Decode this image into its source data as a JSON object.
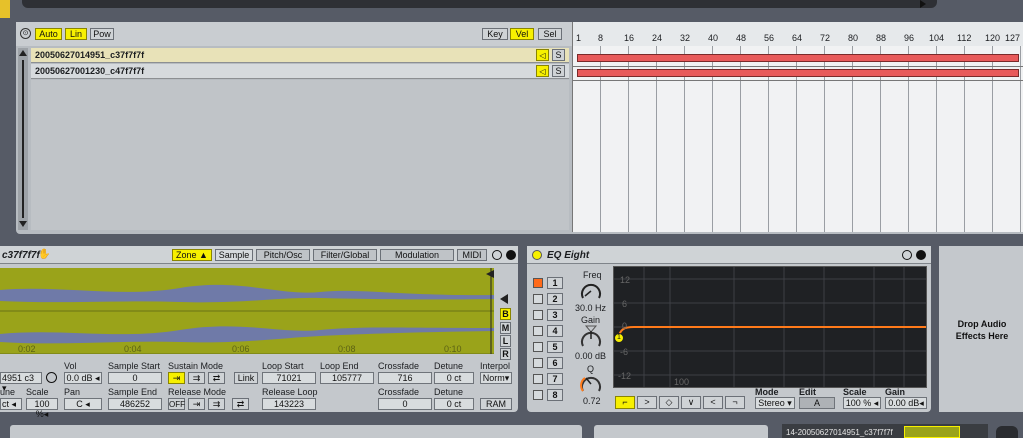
{
  "clip": {
    "buttons": {
      "auto": "Auto",
      "lin": "Lin",
      "pow": "Pow",
      "key": "Key",
      "vel": "Vel",
      "sel": "Sel"
    },
    "ruler": [
      "1",
      "8",
      "16",
      "24",
      "32",
      "40",
      "48",
      "56",
      "64",
      "72",
      "80",
      "88",
      "96",
      "104",
      "112",
      "120",
      "127"
    ],
    "tracks": [
      {
        "name": "20050627014951_c37f7f7f",
        "solo": "S"
      },
      {
        "name": "20050627001230_c47f7f7f",
        "solo": "S"
      }
    ]
  },
  "sampler": {
    "title": "c37f7f7f",
    "tabs": {
      "zone": "Zone",
      "sample": "Sample",
      "pitch": "Pitch/Osc",
      "filter": "Filter/Global",
      "modulation": "Modulation",
      "midi": "MIDI"
    },
    "side_buttons": [
      "B",
      "M",
      "L",
      "R"
    ],
    "timeline": [
      "0:02",
      "0:04",
      "0:06",
      "0:08",
      "0:10"
    ],
    "params": {
      "sample_field": "4951 c3",
      "vol_label": "Vol",
      "vol": "0.0 dB",
      "sample_start_label": "Sample Start",
      "sample_start": "0",
      "sustain_mode_label": "Sustain Mode",
      "link": "Link",
      "loop_start_label": "Loop Start",
      "loop_start": "71021",
      "loop_end_label": "Loop End",
      "loop_end": "105777",
      "crossfade_label": "Crossfade",
      "crossfade": "716",
      "detune_label": "Detune",
      "detune": "0 ct",
      "interpol_label": "Interpol",
      "interpol": "Norm",
      "tune_label": "une",
      "scale_label": "Scale",
      "scale": "100 %",
      "tune_field": "ct",
      "pan_label": "Pan",
      "pan": "C",
      "sample_end_label": "Sample End",
      "sample_end": "486252",
      "release_mode_label": "Release Mode",
      "release_off": "OFF",
      "release_loop_label": "Release Loop",
      "release_loop": "143223",
      "crossfade2_label": "Crossfade",
      "crossfade2": "0",
      "detune2_label": "Detune",
      "detune2": "0 ct",
      "ram": "RAM"
    }
  },
  "eq": {
    "title": "EQ Eight",
    "bands": [
      "1",
      "2",
      "3",
      "4",
      "5",
      "6",
      "7",
      "8"
    ],
    "freq_label": "Freq",
    "freq": "30.0 Hz",
    "gain_label": "Gain",
    "gain": "0.00 dB",
    "q_label": "Q",
    "q": "0.72",
    "y_ticks": [
      "12",
      "6",
      "0",
      "-6",
      "-12"
    ],
    "x_tick": "100",
    "mode_label": "Mode",
    "mode": "Stereo",
    "edit_label": "Edit",
    "edit": "A",
    "scale_label": "Scale",
    "scale": "100 %",
    "gain_out_label": "Gain",
    "gain_out": "0.00 dB"
  },
  "drop": {
    "text": "Drop Audio Effects Here"
  },
  "footer": {
    "clip_name": "14-20050627014951_c37f7f7f"
  },
  "colors": {
    "accent": "#f7f000",
    "clip": "#e85a5a",
    "waveform_bg": "#9aa31a",
    "eq_curve": "#ff7a1a"
  }
}
